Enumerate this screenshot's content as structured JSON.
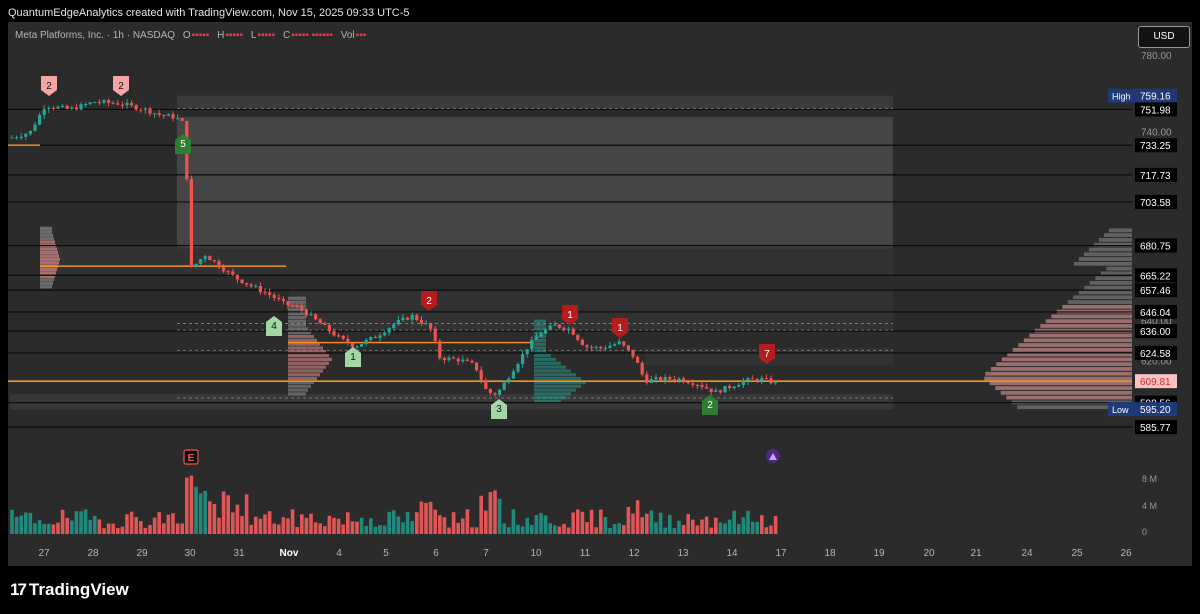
{
  "header": {
    "text": "QuantumEdgeAnalytics created with TradingView.com, Nov 15, 2025 09:33 UTC-5"
  },
  "legend": {
    "symbol": "Meta Platforms, Inc. · 1h · NASDAQ",
    "o_label": "O",
    "h_label": "H",
    "l_label": "L",
    "c_label": "C",
    "vol_label": "Vol"
  },
  "currency": "USD",
  "branding": {
    "name": "TradingView"
  },
  "colors": {
    "up": "#26a69a",
    "down": "#ef5350",
    "poc": "#f7931a",
    "panel": "#2b2b2b",
    "high_low_tag": "#1e3a78"
  },
  "chart_data": {
    "type": "candlestick",
    "price_axis": {
      "ticks": [
        "780.00",
        "740.00",
        "640.00",
        "620.00",
        "0"
      ],
      "price_labels": [
        {
          "value": "759.16",
          "tag": "High"
        },
        {
          "value": "751.98"
        },
        {
          "value": "733.25"
        },
        {
          "value": "717.73"
        },
        {
          "value": "703.58"
        },
        {
          "value": "680.75"
        },
        {
          "value": "665.22"
        },
        {
          "value": "657.46"
        },
        {
          "value": "646.04"
        },
        {
          "value": "636.00"
        },
        {
          "value": "624.58"
        },
        {
          "value": "609.81",
          "current": true
        },
        {
          "value": "598.56"
        },
        {
          "value": "595.20",
          "tag": "Low"
        },
        {
          "value": "585.77"
        }
      ]
    },
    "volume_axis": {
      "ticks": [
        "8 M",
        "4 M",
        "0"
      ]
    },
    "time_axis": [
      "27",
      "28",
      "29",
      "30",
      "31",
      "Nov",
      "4",
      "5",
      "6",
      "7",
      "10",
      "11",
      "12",
      "13",
      "14",
      "17",
      "18",
      "19",
      "20",
      "21",
      "24",
      "25",
      "26"
    ],
    "signals": [
      {
        "label": "2",
        "kind": "sell"
      },
      {
        "label": "2",
        "kind": "sell"
      },
      {
        "label": "5",
        "kind": "buy"
      },
      {
        "label": "4",
        "kind": "buy"
      },
      {
        "label": "1",
        "kind": "buy"
      },
      {
        "label": "2",
        "kind": "sell"
      },
      {
        "label": "3",
        "kind": "buy"
      },
      {
        "label": "1",
        "kind": "sell"
      },
      {
        "label": "1",
        "kind": "sell"
      },
      {
        "label": "7",
        "kind": "sell"
      },
      {
        "label": "2",
        "kind": "buy"
      }
    ],
    "events": [
      {
        "label": "E",
        "kind": "earnings"
      }
    ]
  }
}
